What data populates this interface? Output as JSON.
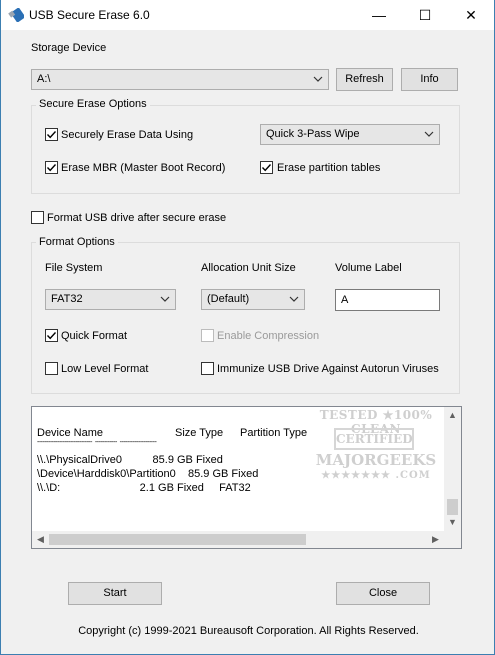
{
  "window": {
    "title": "USB Secure Erase 6.0",
    "minimize_glyph": "—",
    "maximize_glyph": "☐",
    "close_glyph": "✕"
  },
  "storage": {
    "label": "Storage Device",
    "selected": "A:\\",
    "refresh_label": "Refresh",
    "info_label": "Info"
  },
  "secure_erase": {
    "group_title": "Secure Erase Options",
    "securely_erase": {
      "label": "Securely Erase Data Using",
      "checked": true
    },
    "method_selected": "Quick 3-Pass Wipe",
    "erase_mbr": {
      "label": "Erase MBR (Master Boot Record)",
      "checked": true
    },
    "erase_partitions": {
      "label": "Erase partition tables",
      "checked": true
    }
  },
  "format_after": {
    "label": "Format USB drive after secure erase",
    "checked": false
  },
  "format_options": {
    "group_title": "Format Options",
    "file_system_label": "File System",
    "file_system_selected": "FAT32",
    "alloc_label": "Allocation Unit Size",
    "alloc_selected": "(Default)",
    "volume_label_label": "Volume Label",
    "volume_label_value": "A",
    "quick_format": {
      "label": "Quick Format",
      "checked": true
    },
    "enable_compression": {
      "label": "Enable Compression",
      "checked": false,
      "disabled": true
    },
    "low_level": {
      "label": "Low Level Format",
      "checked": false
    },
    "immunize": {
      "label": "Immunize USB Drive Against Autorun Viruses",
      "checked": false
    }
  },
  "device_list": {
    "headers": {
      "device_name": "Device Name",
      "size_type": "Size Type",
      "partition_type": "Partition Type"
    },
    "separator": "------------------------------  ------------  --------------------",
    "rows": [
      "\\\\.\\PhysicalDrive0          85.9 GB Fixed",
      "\\Device\\Harddisk0\\Partition0    85.9 GB Fixed",
      "\\\\.\\D:                          2.1 GB Fixed     FAT32"
    ]
  },
  "watermark": {
    "line1": "TESTED ★100% CLEAN",
    "line2": "CERTIFIED",
    "line3": "MAJORGEEKS",
    "line4": "★★★★★★★ .COM"
  },
  "actions": {
    "start_label": "Start",
    "close_label": "Close"
  },
  "copyright": "Copyright (c) 1999-2021 Bureausoft Corporation. All Rights Reserved."
}
